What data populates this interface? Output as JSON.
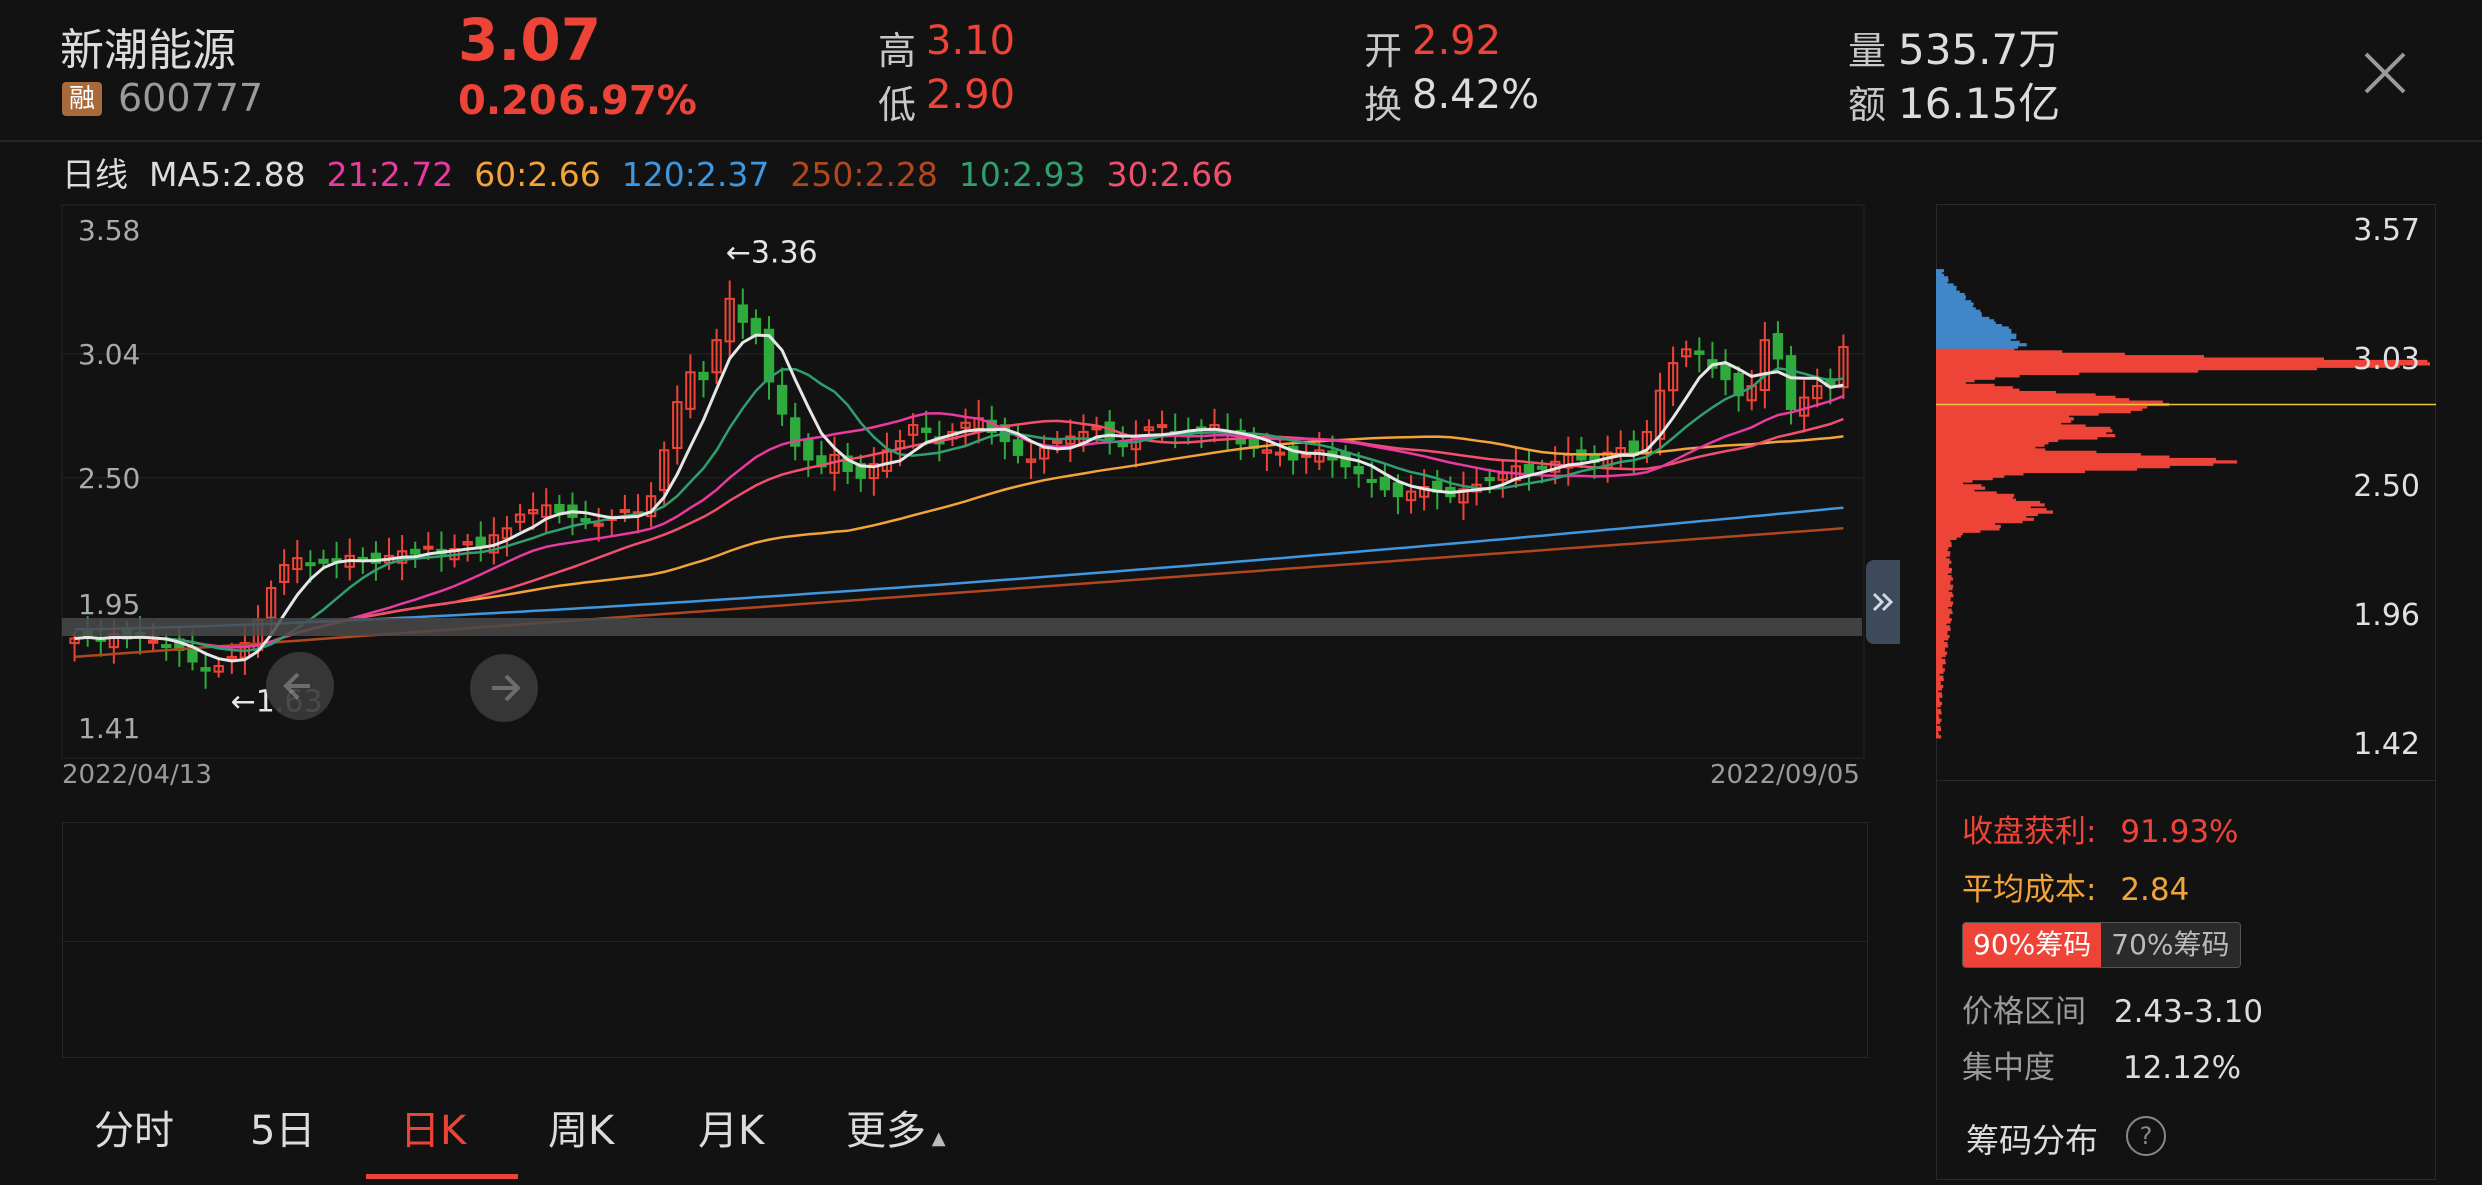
{
  "stock": {
    "name": "新潮能源",
    "badge": "融",
    "code": "600777",
    "price": "3.07",
    "change": "0.20",
    "pct": "6.97%"
  },
  "quote": {
    "high_label": "高",
    "high": "3.10",
    "low_label": "低",
    "low": "2.90",
    "open_label": "开",
    "open": "2.92",
    "turn_label": "换",
    "turn": "8.42%",
    "vol_label": "量",
    "vol": "535.7万",
    "amt_label": "额",
    "amt": "16.15亿"
  },
  "ma_bar": {
    "period": "日线",
    "ma5": "MA5:2.88",
    "ma21": "21:2.72",
    "ma60": "60:2.66",
    "ma120": "120:2.37",
    "ma250": "250:2.28",
    "ma10": "10:2.93",
    "ma30": "30:2.66"
  },
  "colors": {
    "up": "#ee4438",
    "down": "#2faa3c",
    "ma5": "#e6e6e6",
    "ma10": "#2f9f6f",
    "ma21": "#e83aa0",
    "ma30": "#f0506e",
    "ma60": "#f2a33a",
    "ma120": "#3f97e0",
    "ma250": "#b0471f",
    "bg": "#121212"
  },
  "tabs": [
    {
      "label": "分时"
    },
    {
      "label": "5日"
    },
    {
      "label": "日K",
      "active": true
    },
    {
      "label": "周K"
    },
    {
      "label": "月K"
    },
    {
      "label": "更多"
    }
  ],
  "chart_data": {
    "type": "candlestick",
    "x_start": "2022/04/13",
    "x_end": "2022/09/05",
    "y_ticks": [
      "3.58",
      "3.04",
      "2.50",
      "1.95",
      "1.41"
    ],
    "ylim": [
      1.41,
      3.58
    ],
    "high_mark": "←3.36",
    "low_mark": "←1.63",
    "closes": [
      1.8,
      1.81,
      1.79,
      1.82,
      1.8,
      1.81,
      1.79,
      1.77,
      1.75,
      1.7,
      1.66,
      1.68,
      1.72,
      1.78,
      1.88,
      2.02,
      2.12,
      2.15,
      2.12,
      2.13,
      2.14,
      2.16,
      2.14,
      2.13,
      2.16,
      2.18,
      2.17,
      2.2,
      2.17,
      2.19,
      2.22,
      2.2,
      2.25,
      2.28,
      2.34,
      2.36,
      2.38,
      2.35,
      2.33,
      2.32,
      2.3,
      2.33,
      2.36,
      2.35,
      2.42,
      2.62,
      2.83,
      2.96,
      2.93,
      3.1,
      3.28,
      3.18,
      3.12,
      2.92,
      2.78,
      2.64,
      2.58,
      2.55,
      2.6,
      2.53,
      2.5,
      2.56,
      2.62,
      2.66,
      2.73,
      2.7,
      2.65,
      2.7,
      2.74,
      2.76,
      2.7,
      2.66,
      2.6,
      2.58,
      2.63,
      2.66,
      2.68,
      2.7,
      2.72,
      2.67,
      2.64,
      2.68,
      2.72,
      2.73,
      2.7,
      2.69,
      2.71,
      2.73,
      2.69,
      2.65,
      2.63,
      2.62,
      2.61,
      2.58,
      2.6,
      2.62,
      2.58,
      2.55,
      2.52,
      2.49,
      2.45,
      2.42,
      2.44,
      2.46,
      2.44,
      2.42,
      2.45,
      2.47,
      2.49,
      2.52,
      2.55,
      2.52,
      2.54,
      2.57,
      2.6,
      2.58,
      2.57,
      2.61,
      2.63,
      2.6,
      2.7,
      2.88,
      3.0,
      3.06,
      3.04,
      2.98,
      2.93,
      2.86,
      2.9,
      3.1,
      3.02,
      2.8,
      2.85,
      2.9,
      2.9,
      3.07
    ],
    "ma_current": {
      "MA5": 2.88,
      "MA10": 2.93,
      "MA21": 2.72,
      "MA30": 2.66,
      "MA60": 2.66,
      "MA120": 2.37,
      "MA250": 2.28
    }
  },
  "chips": {
    "y_ticks": [
      "3.57",
      "3.03",
      "2.50",
      "1.96",
      "1.42"
    ],
    "profit_label": "收盘获利:",
    "profit": "91.93%",
    "avg_label": "平均成本:",
    "avg": "2.84",
    "btn90": "90%筹码",
    "btn70": "70%筹码",
    "range_label": "价格区间",
    "range": "2.43-3.10",
    "conc_label": "集中度",
    "conc": "12.12%",
    "footer": "筹码分布",
    "help": "?"
  }
}
